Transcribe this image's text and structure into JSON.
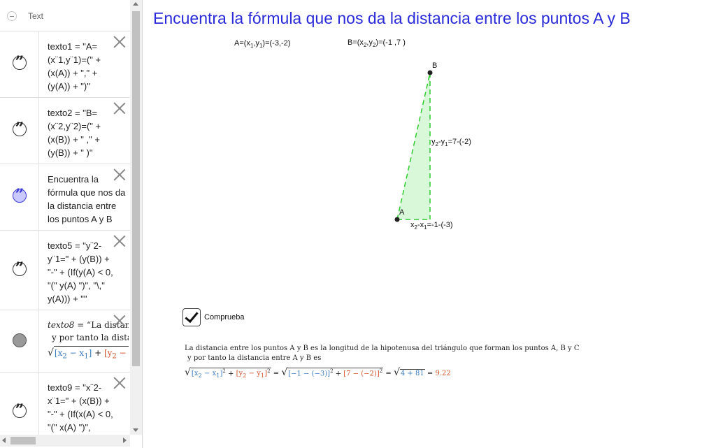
{
  "algebra": {
    "header": "Text",
    "rows": [
      {
        "name": "texto1",
        "marble": "quote",
        "text": "texto1 = \"A=\n(x¨1,y¨1)=(\" +\n(x(A)) + \",\" +\n(y(A)) + \")\""
      },
      {
        "name": "texto2",
        "marble": "quote",
        "text": "texto2 = \"B=\n(x¨2,y¨2)=(\" +\n(x(B)) + \" ,\" +\n(y(B)) + \" )\""
      },
      {
        "name": "texto3",
        "marble": "quote-active",
        "text": "Encuentra la\nfórmula que nos da\nla distancia entre\nlos puntos A y B"
      },
      {
        "name": "texto5",
        "marble": "quote",
        "text": "texto5 = \"y¨2-\ny¨1=\" + (y(B)) +\n\"-\" + (If(y(A) < 0,\n\"(\" y(A) \")\", \"\\,\"\ny(A))) + \"\""
      },
      {
        "name": "texto8",
        "marble": "plain",
        "latex": true,
        "line1_name": "texto8",
        "line1_rest": " = “La distan",
        "line2": "y por tanto la distan"
      },
      {
        "name": "texto9",
        "marble": "quote",
        "text": "texto9 = \"x¨2-\nx¨1=\" + (x(B)) +\n\"-\" + (If(x(A) < 0,\n\"(\" x(A) \")\","
      }
    ]
  },
  "graphics": {
    "title": "Encuentra la fórmula que nos da la distancia entre los puntos A y B",
    "label_A_coords": {
      "pre": "A=(x",
      "s1": "1",
      "mid": ",y",
      "s2": "1",
      "post": ")=(-3,-2)"
    },
    "label_B_coords": {
      "pre": "B=(x",
      "s1": "2",
      "mid": ",y",
      "s2": "2",
      "post": ")=(-1 ,7 )"
    },
    "point_A": "A",
    "point_B": "B",
    "label_dy": {
      "pre": "y",
      "s1": "2",
      "mid": "-y",
      "s2": "1",
      "post": "=7-(-2)"
    },
    "label_dx": {
      "pre": "x",
      "s1": "2",
      "mid": "-x",
      "s2": "1",
      "post": "=-1-(-3)"
    },
    "checkbox_label": "Comprueba",
    "checkbox_checked": true,
    "distance_text_1": "La distancia entre los puntos A y B es la longitud de la hipotenusa del triángulo que forman los puntos A, B y C",
    "distance_text_2": "y por tanto la distancia entre A y B es",
    "formula": {
      "t1": "[x",
      "t1s": "2",
      "t2": " − x",
      "t2s": "1",
      "t3": "]",
      "plus": " + ",
      "u1": "[y",
      "u1s": "2",
      "u2": " − y",
      "u2s": "1",
      "u3": "]",
      "eq": " = ",
      "v1": "[−1 − (−3)]",
      "v2": "[7 − (−2)]",
      "w": "4 + 81",
      "result": "9.22"
    },
    "colors": {
      "title": "#2a2ad8",
      "triangle_fill": "#d9f7d9",
      "triangle_stroke": "#2ecc2e",
      "formula_blue": "#3b7bbf",
      "formula_orange": "#d2522a"
    }
  }
}
